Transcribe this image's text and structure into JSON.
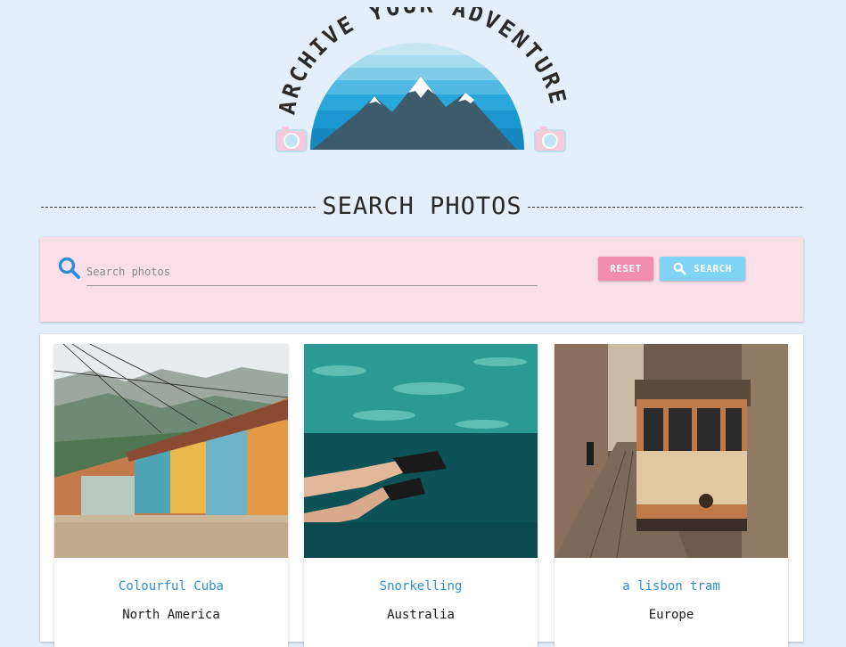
{
  "logo": {
    "text": "ARCHIVE YOUR ADVENTURE"
  },
  "section": {
    "title": "SEARCH PHOTOS"
  },
  "search": {
    "placeholder": "Search photos",
    "value": "",
    "icon": "search-icon",
    "reset_label": "RESET",
    "search_label": "SEARCH"
  },
  "colors": {
    "background": "#e3f0fc",
    "search_panel": "#fbdfe8",
    "reset_button": "#f38db0",
    "search_button": "#7fd3f4",
    "card_title": "#2e8fd6"
  },
  "photos": [
    {
      "title": "Colourful Cuba",
      "region": "North America"
    },
    {
      "title": "Snorkelling",
      "region": "Australia"
    },
    {
      "title": "a lisbon tram",
      "region": "Europe"
    }
  ]
}
